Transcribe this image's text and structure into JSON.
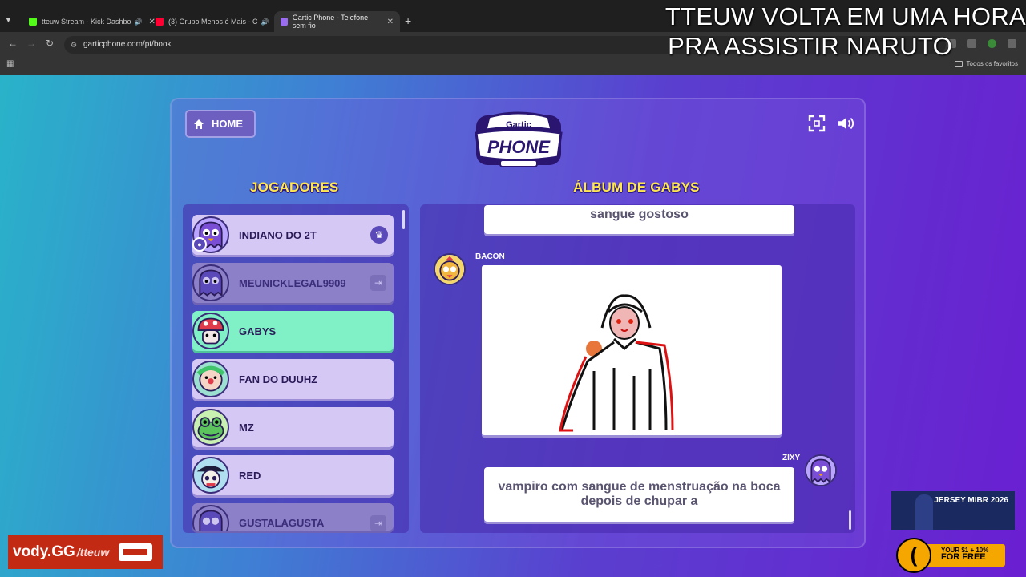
{
  "browser": {
    "tabs": [
      {
        "label": "tteuw Stream - Kick Dashbo",
        "icon_color": "#53fc18"
      },
      {
        "label": "(3) Grupo Menos é Mais - C",
        "icon_color": "#ff0033"
      },
      {
        "label": "Gartic Phone - Telefone sem fio",
        "icon_color": "#9a6cf0"
      }
    ],
    "url": "garticphone.com/pt/book",
    "bookmarks_label": "Todos os favoritos"
  },
  "stream_overlay": {
    "line1": "TTEUW VOLTA EM UMA HORA",
    "line2": "PRA ASSISTIR NARUTO"
  },
  "game": {
    "home_label": "HOME",
    "logo_top": "Gartic",
    "logo_bottom": "PHONE",
    "players_heading": "JOGADORES",
    "album_heading": "ÁLBUM DE GABYS",
    "players": [
      {
        "name": "INDIANO DO 2T",
        "state": "host"
      },
      {
        "name": "MEUNICKLEGAL9909",
        "state": "away"
      },
      {
        "name": "GABYS",
        "state": "selected"
      },
      {
        "name": "FAN DO DUUHZ",
        "state": "normal"
      },
      {
        "name": "MZ",
        "state": "normal"
      },
      {
        "name": "RED",
        "state": "normal"
      },
      {
        "name": "GUSTALAGUSTA",
        "state": "away"
      }
    ],
    "album": {
      "top_text": "sangue gostoso",
      "drawing_author": "BACON",
      "reply_author": "ZIXY",
      "reply_text": "vampiro com sangue de menstruação na boca depois de chupar a"
    }
  },
  "ads": {
    "vody": "vody.GG",
    "vody_channel": "/tteuw",
    "mibr": "JERSEY MIBR 2026",
    "promo_line1": "YOUR $1 + 10%",
    "promo_line2": "FOR FREE"
  }
}
